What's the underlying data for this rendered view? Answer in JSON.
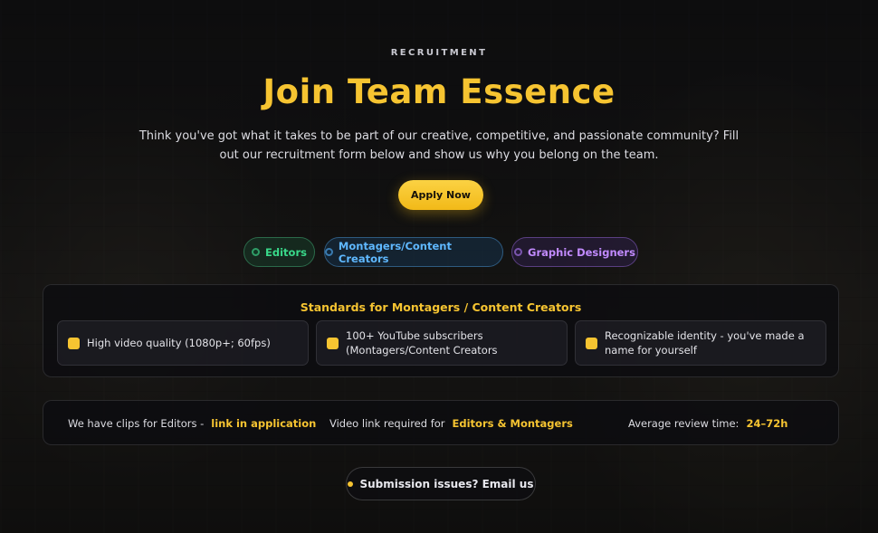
{
  "hero": {
    "eyebrow": "RECRUITMENT",
    "title": "Join Team Essence",
    "subtitle": "Think you've got what it takes to be part of our creative, competitive, and passionate community? Fill out our recruitment form below and show us why you belong on the team.",
    "apply_label": "Apply Now"
  },
  "tabs": [
    {
      "label": "Editors",
      "color": "#39d98a"
    },
    {
      "label": "Montagers/Content Creators",
      "color": "#5fb8ff"
    },
    {
      "label": "Graphic Designers",
      "color": "#c28bff"
    }
  ],
  "standards": {
    "title": "Standards for Montagers / Content Creators",
    "items": [
      {
        "text": "High video quality (1080p+; 60fps)"
      },
      {
        "text": "100+ YouTube subscribers (Montagers/Content Creators"
      },
      {
        "text": "Recognizable identity - you've made a name for yourself"
      }
    ]
  },
  "info": {
    "clips_text": "We have clips for Editors -",
    "clips_link": "link in application",
    "video_text": "Video link required for",
    "video_highlight": "Editors & Montagers",
    "review_text": "Average review time:",
    "review_value": "24–72h"
  },
  "footer": {
    "submission_label": "Submission issues? Email us"
  },
  "colors": {
    "accent": "#f6c431"
  }
}
